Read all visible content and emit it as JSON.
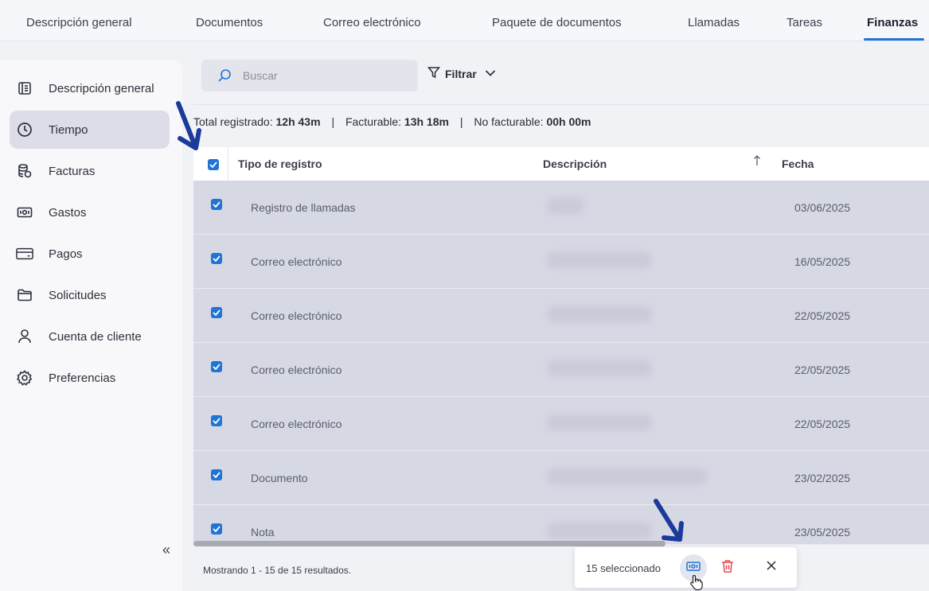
{
  "tabs": [
    {
      "label": "Descripción general"
    },
    {
      "label": "Documentos"
    },
    {
      "label": "Correo electrónico"
    },
    {
      "label": "Paquete de documentos"
    },
    {
      "label": "Llamadas"
    },
    {
      "label": "Tareas"
    },
    {
      "label": "Finanzas"
    }
  ],
  "active_tab": "Finanzas",
  "sidebar": {
    "items": [
      {
        "label": "Descripción general",
        "icon": "overview-icon"
      },
      {
        "label": "Tiempo",
        "icon": "clock-icon"
      },
      {
        "label": "Facturas",
        "icon": "invoice-icon"
      },
      {
        "label": "Gastos",
        "icon": "expense-icon"
      },
      {
        "label": "Pagos",
        "icon": "payment-card-icon"
      },
      {
        "label": "Solicitudes",
        "icon": "folder-icon"
      },
      {
        "label": "Cuenta de cliente",
        "icon": "user-icon"
      },
      {
        "label": "Preferencias",
        "icon": "gear-icon"
      }
    ],
    "active": "Tiempo",
    "collapse_glyph": "«"
  },
  "search": {
    "placeholder": "Buscar"
  },
  "filter": {
    "label": "Filtrar"
  },
  "summary": {
    "total_label": "Total registrado:",
    "total_value": "12h 43m",
    "billable_label": "Facturable:",
    "billable_value": "13h 18m",
    "nonbillable_label": "No facturable:",
    "nonbillable_value": "00h 00m",
    "separator": "|"
  },
  "table": {
    "columns": [
      "Tipo de registro",
      "Descripción",
      "Fecha"
    ],
    "rows": [
      {
        "type": "Registro de llamadas",
        "date": "03/06/2025",
        "checked": true
      },
      {
        "type": "Correo electrónico",
        "date": "16/05/2025",
        "checked": true
      },
      {
        "type": "Correo electrónico",
        "date": "22/05/2025",
        "checked": true
      },
      {
        "type": "Correo electrónico",
        "date": "22/05/2025",
        "checked": true
      },
      {
        "type": "Correo electrónico",
        "date": "22/05/2025",
        "checked": true
      },
      {
        "type": "Documento",
        "date": "23/02/2025",
        "checked": true
      },
      {
        "type": "Nota",
        "date": "23/05/2025",
        "checked": true
      }
    ]
  },
  "results_text": "Mostrando 1 - 15 de 15 resultados.",
  "bulk_actions": {
    "selected_text": "15 seleccionado"
  },
  "colors": {
    "accent": "#1f74d6",
    "row_selected": "#d6d8e4",
    "delete": "#e5484d",
    "annotation_arrow": "#1a3a9c"
  }
}
